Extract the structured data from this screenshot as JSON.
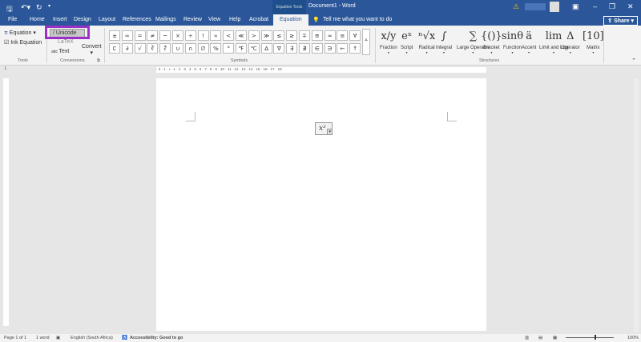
{
  "titlebar": {
    "title": "Document1 - Word",
    "context": "Equation Tools"
  },
  "tabs": [
    "File",
    "Home",
    "Insert",
    "Design",
    "Layout",
    "References",
    "Mailings",
    "Review",
    "View",
    "Help",
    "Acrobat",
    "Equation"
  ],
  "tell_me": "Tell me what you want to do",
  "share": "Share",
  "tools": {
    "equation": "Equation",
    "ink": "Ink Equation",
    "label": "Tools"
  },
  "conversions": {
    "unicode": "Unicode",
    "latex": "LaTeX",
    "text": "Text",
    "convert": "Convert",
    "label": "Conversions"
  },
  "symbols": {
    "row1": [
      "±",
      "∞",
      "=",
      "≠",
      "~",
      "×",
      "÷",
      "!",
      "∝",
      "<",
      "≪",
      ">",
      "≫",
      "≤",
      "≥",
      "∓",
      "≅",
      "≈",
      "≡",
      "∀"
    ],
    "row2": [
      "∁",
      "∂",
      "√",
      "∛",
      "∜",
      "∪",
      "∩",
      "∅",
      "%",
      "°",
      "℉",
      "℃",
      "∆",
      "∇",
      "∃",
      "∄",
      "∈",
      "∋",
      "←",
      "↑"
    ],
    "label": "Symbols"
  },
  "structures": {
    "items": [
      {
        "glyph": "x/y",
        "label": "Fraction"
      },
      {
        "glyph": "eˣ",
        "label": "Script"
      },
      {
        "glyph": "ⁿ√x",
        "label": "Radical"
      },
      {
        "glyph": "∫",
        "label": "Integral"
      },
      {
        "glyph": "∑",
        "label": "Large Operator"
      },
      {
        "glyph": "{()}",
        "label": "Bracket"
      },
      {
        "glyph": "sinθ",
        "label": "Function"
      },
      {
        "glyph": "ä",
        "label": "Accent"
      },
      {
        "glyph": "lim",
        "label": "Limit and Log"
      },
      {
        "glyph": "Δ",
        "label": "Operator"
      },
      {
        "glyph": "[10]",
        "label": "Matrix"
      }
    ],
    "label": "Structures"
  },
  "ruler": "· 2 · 1 · ▪ · 1 · 2 · 3 · 4 · 5 · 6 · 7 · 8 · 9 · 10 · 11 · 12 · 13 · 14 · 15 · 16 · 17 · 18",
  "equation": "x²",
  "status": {
    "page": "Page 1 of 1",
    "words": "1 word",
    "language": "English (South Africa)",
    "accessibility": "Accessibility: Good to go",
    "zoom": "100%"
  }
}
